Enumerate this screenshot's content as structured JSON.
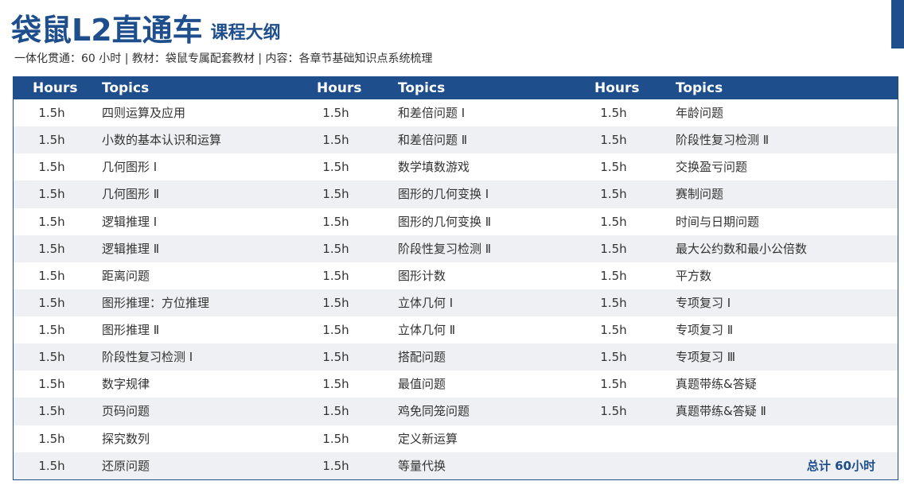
{
  "header": {
    "title": "袋鼠L2直通车",
    "subtitle_title": "课程大纲",
    "info": "一体化贯通：60 小时 | 教材：袋鼠专属配套教材 | 内容：各章节基础知识点系统梳理"
  },
  "columns": {
    "hours_label": "Hours",
    "topics_label": "Topics"
  },
  "rows": [
    {
      "c1": {
        "h": "1.5h",
        "t": "四则运算及应用"
      },
      "c2": {
        "h": "1.5h",
        "t": "和差倍问题 Ⅰ"
      },
      "c3": {
        "h": "1.5h",
        "t": "年龄问题"
      }
    },
    {
      "c1": {
        "h": "1.5h",
        "t": "小数的基本认识和运算"
      },
      "c2": {
        "h": "1.5h",
        "t": "和差倍问题 Ⅱ"
      },
      "c3": {
        "h": "1.5h",
        "t": "阶段性复习检测 Ⅱ"
      }
    },
    {
      "c1": {
        "h": "1.5h",
        "t": "几何图形 Ⅰ"
      },
      "c2": {
        "h": "1.5h",
        "t": "数学填数游戏"
      },
      "c3": {
        "h": "1.5h",
        "t": "交换盈亏问题"
      }
    },
    {
      "c1": {
        "h": "1.5h",
        "t": "几何图形 Ⅱ"
      },
      "c2": {
        "h": "1.5h",
        "t": "图形的几何变换 Ⅰ"
      },
      "c3": {
        "h": "1.5h",
        "t": "赛制问题"
      }
    },
    {
      "c1": {
        "h": "1.5h",
        "t": "逻辑推理 Ⅰ"
      },
      "c2": {
        "h": "1.5h",
        "t": "图形的几何变换 Ⅱ"
      },
      "c3": {
        "h": "1.5h",
        "t": "时间与日期问题"
      }
    },
    {
      "c1": {
        "h": "1.5h",
        "t": "逻辑推理 Ⅱ"
      },
      "c2": {
        "h": "1.5h",
        "t": "阶段性复习检测 Ⅱ"
      },
      "c3": {
        "h": "1.5h",
        "t": "最大公约数和最小公倍数"
      }
    },
    {
      "c1": {
        "h": "1.5h",
        "t": "距离问题"
      },
      "c2": {
        "h": "1.5h",
        "t": "图形计数"
      },
      "c3": {
        "h": "1.5h",
        "t": "平方数"
      }
    },
    {
      "c1": {
        "h": "1.5h",
        "t": "图形推理：方位推理"
      },
      "c2": {
        "h": "1.5h",
        "t": "立体几何 Ⅰ"
      },
      "c3": {
        "h": "1.5h",
        "t": "专项复习 Ⅰ"
      }
    },
    {
      "c1": {
        "h": "1.5h",
        "t": "图形推理 Ⅱ"
      },
      "c2": {
        "h": "1.5h",
        "t": "立体几何 Ⅱ"
      },
      "c3": {
        "h": "1.5h",
        "t": "专项复习 Ⅱ"
      }
    },
    {
      "c1": {
        "h": "1.5h",
        "t": "阶段性复习检测 Ⅰ"
      },
      "c2": {
        "h": "1.5h",
        "t": "搭配问题"
      },
      "c3": {
        "h": "1.5h",
        "t": "专项复习 Ⅲ"
      }
    },
    {
      "c1": {
        "h": "1.5h",
        "t": "数字规律"
      },
      "c2": {
        "h": "1.5h",
        "t": "最值问题"
      },
      "c3": {
        "h": "1.5h",
        "t": "真题带练&答疑"
      }
    },
    {
      "c1": {
        "h": "1.5h",
        "t": "页码问题"
      },
      "c2": {
        "h": "1.5h",
        "t": "鸡免同笼问题"
      },
      "c3": {
        "h": "1.5h",
        "t": "真题带练&答疑 Ⅱ"
      }
    },
    {
      "c1": {
        "h": "1.5h",
        "t": "探究数列"
      },
      "c2": {
        "h": "1.5h",
        "t": "定义新运算"
      },
      "c3": {
        "h": "",
        "t": ""
      }
    },
    {
      "c1": {
        "h": "1.5h",
        "t": "还原问题"
      },
      "c2": {
        "h": "1.5h",
        "t": "等量代换"
      },
      "c3": {
        "h": "",
        "t": ""
      }
    }
  ],
  "total": "总计 60小时",
  "colors": {
    "brand": "#1f4e8c",
    "row_alt": "#eef0f3"
  }
}
